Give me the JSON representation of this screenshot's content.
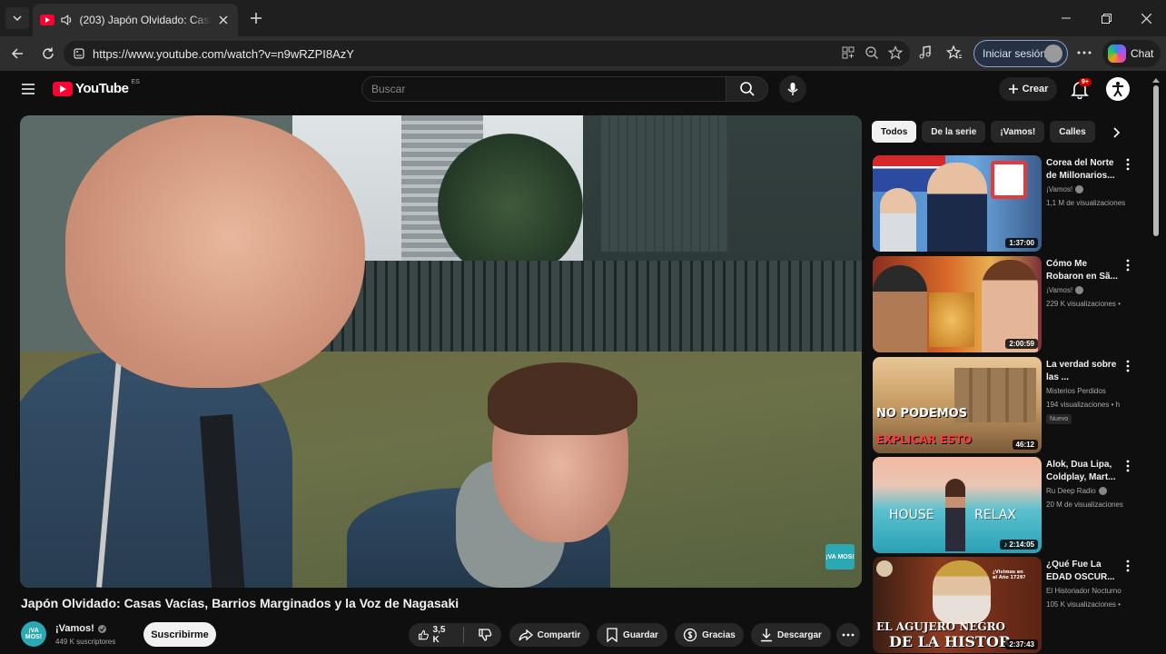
{
  "browser": {
    "tab_title": "(203) Japón Olvidado: Casas V",
    "url": "https://www.youtube.com/watch?v=n9wRZPI8AzY",
    "signin_label": "Iniciar sesión",
    "chat_label": "Chat"
  },
  "masthead": {
    "logo_text": "YouTube",
    "country_code": "ES",
    "search_placeholder": "Buscar",
    "create_label": "Crear",
    "notif_count": "9+"
  },
  "video": {
    "watermark": "¡VA MOS!",
    "title": "Japón Olvidado: Casas Vacías, Barrios Marginados y la Voz de Nagasaki",
    "channel": "¡Vamos!",
    "subscribers": "449 K suscriptores",
    "subscribe_label": "Suscribirme",
    "likes": "3,5 K",
    "share_label": "Compartir",
    "save_label": "Guardar",
    "thanks_label": "Gracias",
    "download_label": "Descargar"
  },
  "chips": [
    "Todos",
    "De la serie",
    "¡Vamos!",
    "Calles"
  ],
  "recommendations": [
    {
      "title": "Corea del Norte de Millonarios...",
      "channel": "¡Vamos!",
      "verified": true,
      "views": "1,1 M de visualizaciones",
      "duration": "1:37:00",
      "new": false
    },
    {
      "title": "Cómo Me Robaron en Sã...",
      "channel": "¡Vamos!",
      "verified": true,
      "views": "229 K visualizaciones •",
      "duration": "2:00:59",
      "new": false
    },
    {
      "title": "La verdad sobre las ...",
      "channel": "Misterios Perdidos",
      "verified": false,
      "views": "194 visualizaciones • h",
      "duration": "46:12",
      "new": true,
      "badge": "Nuevo",
      "thumb_text_1": "NO PODEMOS",
      "thumb_text_2": "EXPLICAR ESTO"
    },
    {
      "title": "Alok, Dua Lipa, Coldplay, Mart...",
      "channel": "Ru Deep Radio",
      "verified": true,
      "views": "20 M de visualizaciones",
      "duration": "2:14:05",
      "new": false,
      "thumb_text_1": "HOUSE",
      "thumb_text_2": "RELAX"
    },
    {
      "title": "¿Qué Fue La EDAD OSCUR...",
      "channel": "El Historiador Nocturno",
      "verified": false,
      "views": "105 K visualizaciones •",
      "duration": "2:37:43",
      "new": false,
      "thumb_text_1": "EL AGUJERO NEGRO",
      "thumb_text_2": "DE LA HISTOR",
      "thumb_text_3": "¿Vivimos en el Año 1729?"
    }
  ],
  "colors": {
    "accent": "#ff0033",
    "background": "#0f0f0f",
    "chip_bg": "#272727"
  }
}
